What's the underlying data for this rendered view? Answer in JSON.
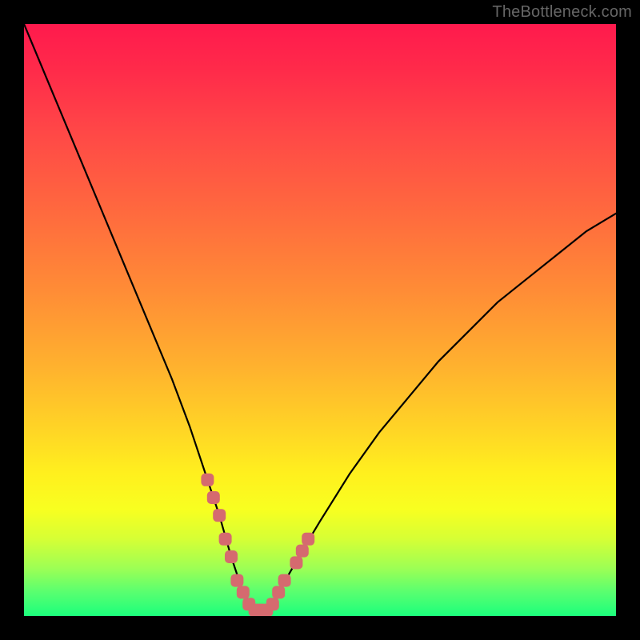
{
  "watermark": "TheBottleneck.com",
  "chart_data": {
    "type": "line",
    "title": "",
    "xlabel": "",
    "ylabel": "",
    "xlim": [
      0,
      100
    ],
    "ylim": [
      0,
      100
    ],
    "grid": false,
    "series": [
      {
        "name": "bottleneck-curve",
        "x": [
          0,
          5,
          10,
          15,
          20,
          25,
          28,
          31,
          33,
          35,
          37,
          39,
          41,
          43,
          47,
          50,
          55,
          60,
          65,
          70,
          75,
          80,
          85,
          90,
          95,
          100
        ],
        "values": [
          100,
          88,
          76,
          64,
          52,
          40,
          32,
          23,
          17,
          10,
          4,
          1,
          1,
          4,
          11,
          16,
          24,
          31,
          37,
          43,
          48,
          53,
          57,
          61,
          65,
          68
        ]
      }
    ],
    "markers": {
      "name": "highlight-points",
      "color": "#d56a6f",
      "points": [
        {
          "x": 31,
          "y": 23
        },
        {
          "x": 32,
          "y": 20
        },
        {
          "x": 33,
          "y": 17
        },
        {
          "x": 34,
          "y": 13
        },
        {
          "x": 35,
          "y": 10
        },
        {
          "x": 36,
          "y": 6
        },
        {
          "x": 37,
          "y": 4
        },
        {
          "x": 38,
          "y": 2
        },
        {
          "x": 39,
          "y": 1
        },
        {
          "x": 40,
          "y": 1
        },
        {
          "x": 41,
          "y": 1
        },
        {
          "x": 42,
          "y": 2
        },
        {
          "x": 43,
          "y": 4
        },
        {
          "x": 44,
          "y": 6
        },
        {
          "x": 46,
          "y": 9
        },
        {
          "x": 47,
          "y": 11
        },
        {
          "x": 48,
          "y": 13
        }
      ]
    }
  }
}
